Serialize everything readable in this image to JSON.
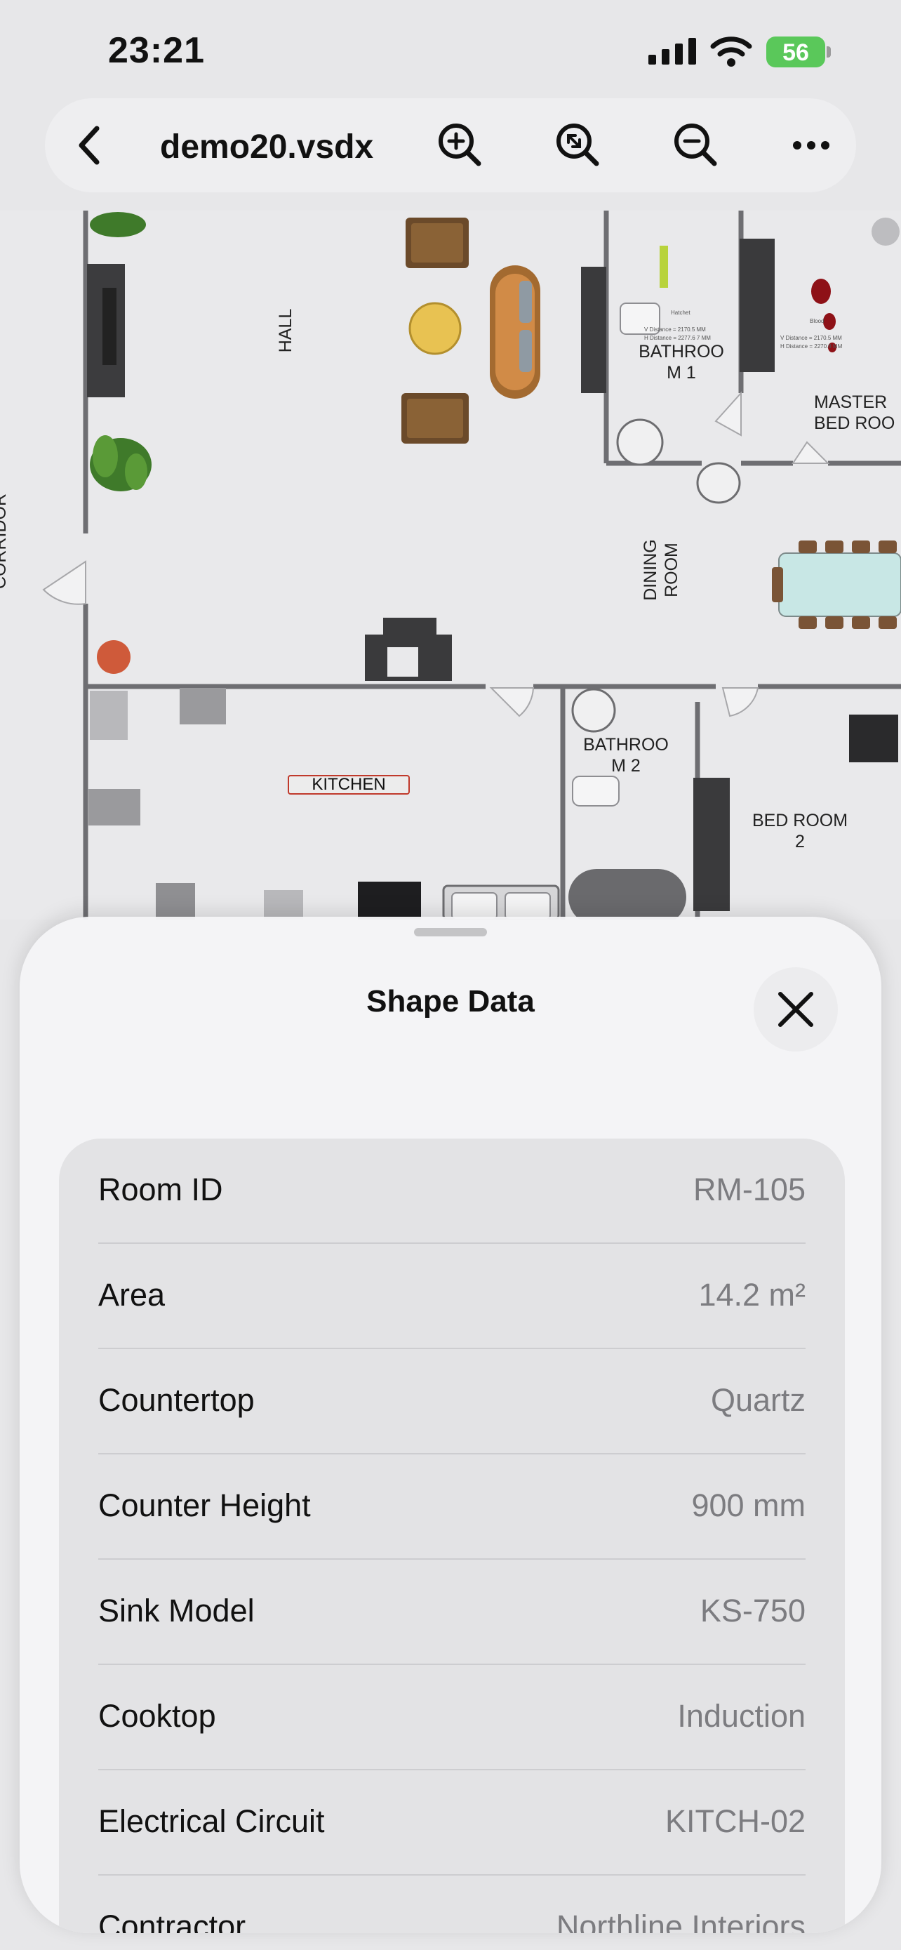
{
  "status_bar": {
    "time": "23:21",
    "battery": "56"
  },
  "toolbar": {
    "title": "demo20.vsdx",
    "icons": [
      "chevron-left-icon",
      "zoom-in-icon",
      "zoom-fit-icon",
      "zoom-out-icon",
      "more-icon"
    ]
  },
  "floor_plan": {
    "rooms": {
      "hall": "HALL",
      "bathroom1": "BATHROO\nM 1",
      "master": "MASTER\nBED ROO",
      "dining": "DINING ROOM",
      "bathroom2": "BATHROO\nM 2",
      "bedroom2": "BED ROOM\n2",
      "kitchen": "KITCHEN",
      "corridor": "CORRIDOR"
    }
  },
  "sheet": {
    "title": "Shape Data",
    "rows": [
      {
        "label": "Room ID",
        "value": "RM-105"
      },
      {
        "label": "Area",
        "value": "14.2 m²"
      },
      {
        "label": "Countertop",
        "value": "Quartz"
      },
      {
        "label": "Counter Height",
        "value": "900 mm"
      },
      {
        "label": "Sink Model",
        "value": "KS-750"
      },
      {
        "label": "Cooktop",
        "value": "Induction"
      },
      {
        "label": "Electrical Circuit",
        "value": "KITCH-02"
      },
      {
        "label": "Contractor",
        "value": "Northline Interiors"
      }
    ]
  },
  "colors": {
    "accent_battery": "#5ac85a",
    "text_secondary": "#7c7c80"
  }
}
